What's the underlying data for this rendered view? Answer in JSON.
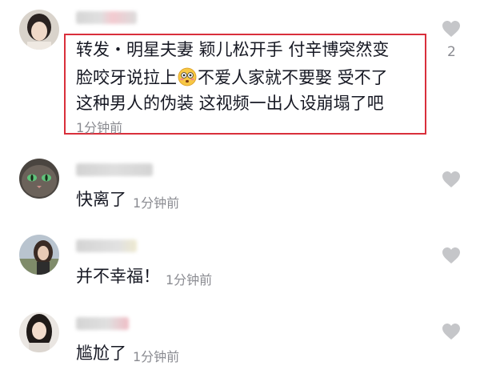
{
  "comments": [
    {
      "line1": "转发・明星夫妻 颖儿松开手 付辛博突然变",
      "line2a": "脸咬牙说拉上",
      "line2b": "不爱人家就不要娶 受不了",
      "line3": "这种男人的伪装 这视频一出人设崩塌了吧",
      "time": "1分钟前",
      "likes": "2",
      "emoji": "flushed-face-emoji"
    },
    {
      "text": "快离了",
      "time": "1分钟前"
    },
    {
      "text": "并不幸福！",
      "time": "1分钟前"
    },
    {
      "text": "尴尬了",
      "time": "1分钟前"
    }
  ],
  "icons": {
    "like": "heart-outline-icon"
  },
  "colors": {
    "highlight_border": "#d92f3b",
    "heart": "#c5c6c9",
    "time": "#8a8b91"
  }
}
